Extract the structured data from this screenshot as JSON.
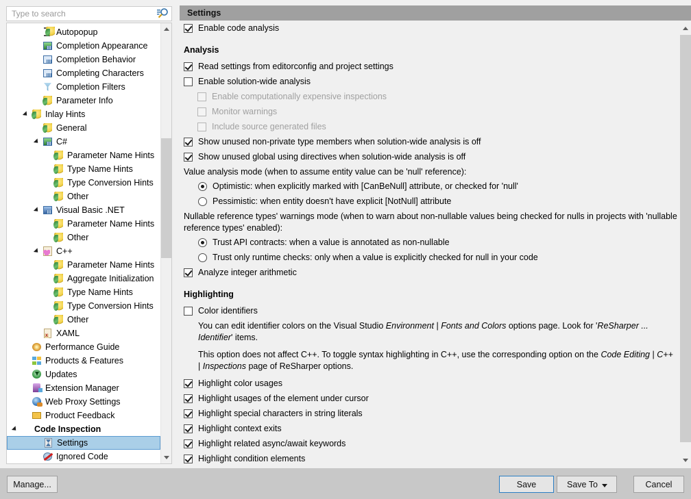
{
  "search": {
    "placeholder": "Type to search",
    "value": "",
    "icon": "search-icon"
  },
  "tree": {
    "items": [
      {
        "label": "Autopopup",
        "indent": 3,
        "icon": "ibeam-bulb-icon",
        "expander": "none",
        "bold": false,
        "selected": false
      },
      {
        "label": "Completion Appearance",
        "indent": 3,
        "icon": "completion-appearance-icon",
        "expander": "none",
        "bold": false,
        "selected": false
      },
      {
        "label": "Completion Behavior",
        "indent": 3,
        "icon": "completion-behavior-icon",
        "expander": "none",
        "bold": false,
        "selected": false
      },
      {
        "label": "Completing Characters",
        "indent": 3,
        "icon": "completing-characters-icon",
        "expander": "none",
        "bold": false,
        "selected": false
      },
      {
        "label": "Completion Filters",
        "indent": 3,
        "icon": "funnel-icon",
        "expander": "none",
        "bold": false,
        "selected": false
      },
      {
        "label": "Parameter Info",
        "indent": 3,
        "icon": "bulb-icon",
        "expander": "none",
        "bold": false,
        "selected": false
      },
      {
        "label": "Inlay Hints",
        "indent": 2,
        "icon": "bulb-icon",
        "expander": "expanded",
        "bold": false,
        "selected": false
      },
      {
        "label": "General",
        "indent": 3,
        "icon": "bulb-icon",
        "expander": "none",
        "bold": false,
        "selected": false
      },
      {
        "label": "C#",
        "indent": 3,
        "icon": "csharp-icon",
        "expander": "expanded",
        "bold": false,
        "selected": false
      },
      {
        "label": "Parameter Name Hints",
        "indent": 4,
        "icon": "bulb-icon",
        "expander": "none",
        "bold": false,
        "selected": false
      },
      {
        "label": "Type Name Hints",
        "indent": 4,
        "icon": "bulb-icon",
        "expander": "none",
        "bold": false,
        "selected": false
      },
      {
        "label": "Type Conversion Hints",
        "indent": 4,
        "icon": "bulb-icon",
        "expander": "none",
        "bold": false,
        "selected": false
      },
      {
        "label": "Other",
        "indent": 4,
        "icon": "bulb-icon",
        "expander": "none",
        "bold": false,
        "selected": false
      },
      {
        "label": "Visual Basic .NET",
        "indent": 3,
        "icon": "vb-icon",
        "expander": "expanded",
        "bold": false,
        "selected": false
      },
      {
        "label": "Parameter Name Hints",
        "indent": 4,
        "icon": "bulb-icon",
        "expander": "none",
        "bold": false,
        "selected": false
      },
      {
        "label": "Other",
        "indent": 4,
        "icon": "bulb-icon",
        "expander": "none",
        "bold": false,
        "selected": false
      },
      {
        "label": "C++",
        "indent": 3,
        "icon": "cpp-icon",
        "expander": "expanded",
        "bold": false,
        "selected": false
      },
      {
        "label": "Parameter Name Hints",
        "indent": 4,
        "icon": "bulb-icon",
        "expander": "none",
        "bold": false,
        "selected": false
      },
      {
        "label": "Aggregate Initialization",
        "indent": 4,
        "icon": "bulb-icon",
        "expander": "none",
        "bold": false,
        "selected": false
      },
      {
        "label": "Type Name Hints",
        "indent": 4,
        "icon": "bulb-icon",
        "expander": "none",
        "bold": false,
        "selected": false
      },
      {
        "label": "Type Conversion Hints",
        "indent": 4,
        "icon": "bulb-icon",
        "expander": "none",
        "bold": false,
        "selected": false
      },
      {
        "label": "Other",
        "indent": 4,
        "icon": "bulb-icon",
        "expander": "none",
        "bold": false,
        "selected": false
      },
      {
        "label": "XAML",
        "indent": 3,
        "icon": "xaml-icon",
        "expander": "none",
        "bold": false,
        "selected": false
      },
      {
        "label": "Performance Guide",
        "indent": 2,
        "icon": "snail-icon",
        "expander": "none",
        "bold": false,
        "selected": false
      },
      {
        "label": "Products & Features",
        "indent": 2,
        "icon": "products-icon",
        "expander": "none",
        "bold": false,
        "selected": false
      },
      {
        "label": "Updates",
        "indent": 2,
        "icon": "updates-icon",
        "expander": "none",
        "bold": false,
        "selected": false
      },
      {
        "label": "Extension Manager",
        "indent": 2,
        "icon": "extension-manager-icon",
        "expander": "none",
        "bold": false,
        "selected": false
      },
      {
        "label": "Web Proxy Settings",
        "indent": 2,
        "icon": "globe-icon",
        "expander": "none",
        "bold": false,
        "selected": false
      },
      {
        "label": "Product Feedback",
        "indent": 2,
        "icon": "mail-icon",
        "expander": "none",
        "bold": false,
        "selected": false
      },
      {
        "label": "Code Inspection",
        "indent": 1,
        "icon": "none",
        "expander": "expanded",
        "bold": true,
        "selected": false
      },
      {
        "label": "Settings",
        "indent": 3,
        "icon": "hourglass-icon",
        "expander": "none",
        "bold": false,
        "selected": true
      },
      {
        "label": "Ignored Code",
        "indent": 3,
        "icon": "no-entry-icon",
        "expander": "none",
        "bold": false,
        "selected": false
      }
    ]
  },
  "panel": {
    "title": "Settings",
    "enable_code_analysis": {
      "label": "Enable code analysis",
      "checked": true,
      "enabled": true
    },
    "analysis": {
      "heading": "Analysis",
      "checkboxes": [
        {
          "label": "Read settings from editorconfig and project settings",
          "checked": true,
          "enabled": true,
          "indent": 0
        },
        {
          "label": "Enable solution-wide analysis",
          "checked": false,
          "enabled": true,
          "indent": 0
        },
        {
          "label": "Enable computationally expensive inspections",
          "checked": false,
          "enabled": false,
          "indent": 1
        },
        {
          "label": "Monitor warnings",
          "checked": false,
          "enabled": false,
          "indent": 1
        },
        {
          "label": "Include source generated files",
          "checked": false,
          "enabled": false,
          "indent": 1
        },
        {
          "label": "Show unused non-private type members when solution-wide analysis is off",
          "checked": true,
          "enabled": true,
          "indent": 0
        },
        {
          "label": "Show unused global using directives when solution-wide analysis is off",
          "checked": true,
          "enabled": true,
          "indent": 0
        }
      ],
      "value_mode_caption": "Value analysis mode (when to assume entity value can be 'null' reference):",
      "value_mode_options": [
        {
          "label": "Optimistic: when explicitly marked with [CanBeNull] attribute, or checked for 'null'",
          "selected": true
        },
        {
          "label": "Pessimistic: when entity doesn't have explicit [NotNull] attribute",
          "selected": false
        }
      ],
      "nullable_caption": "Nullable reference types' warnings mode (when to warn about non-nullable values being checked for nulls in projects with 'nullable reference types' enabled):",
      "nullable_options": [
        {
          "label": "Trust API contracts: when a value is annotated as non-nullable",
          "selected": true
        },
        {
          "label": "Trust only runtime checks: only when a value is explicitly checked for null in your code",
          "selected": false
        }
      ],
      "analyze_integer": {
        "label": "Analyze integer arithmetic",
        "checked": true,
        "enabled": true
      }
    },
    "highlighting": {
      "heading": "Highlighting",
      "color_identifiers": {
        "label": "Color identifiers",
        "checked": false,
        "enabled": true
      },
      "help_1_parts": [
        {
          "text": "You can edit identifier colors on the Visual Studio ",
          "italic": false
        },
        {
          "text": "Environment",
          "italic": true
        },
        {
          "text": " | ",
          "italic": false
        },
        {
          "text": "Fonts and Colors",
          "italic": true
        },
        {
          "text": " options page. Look for '",
          "italic": false
        },
        {
          "text": "ReSharper ... Identifier",
          "italic": true
        },
        {
          "text": "' items.",
          "italic": false
        }
      ],
      "help_2_parts": [
        {
          "text": "This option does not affect C++. To toggle syntax highlighting in C++, use the corresponding option on the ",
          "italic": false
        },
        {
          "text": "Code Editing",
          "italic": true
        },
        {
          "text": " | ",
          "italic": false
        },
        {
          "text": "C++",
          "italic": true
        },
        {
          "text": " | ",
          "italic": false
        },
        {
          "text": "Inspections",
          "italic": true
        },
        {
          "text": " page of ReSharper options.",
          "italic": false
        }
      ],
      "checkboxes": [
        {
          "label": "Highlight color usages",
          "checked": true,
          "enabled": true
        },
        {
          "label": "Highlight usages of the element under cursor",
          "checked": true,
          "enabled": true
        },
        {
          "label": "Highlight special characters in string literals",
          "checked": true,
          "enabled": true
        },
        {
          "label": "Highlight context exits",
          "checked": true,
          "enabled": true
        },
        {
          "label": "Highlight related async/await keywords",
          "checked": true,
          "enabled": true
        },
        {
          "label": "Highlight condition elements",
          "checked": true,
          "enabled": true
        }
      ]
    }
  },
  "buttons": {
    "manage": "Manage...",
    "save": "Save",
    "save_to": "Save To",
    "cancel": "Cancel"
  },
  "colors": {
    "header_bar": "#a0a0a0",
    "selection": "#aacfe8",
    "selection_border": "#5b9bd1",
    "default_button_border": "#2a7ec4",
    "dialog_background": "#c8c8c8",
    "pane_background": "#f0f0f0"
  }
}
